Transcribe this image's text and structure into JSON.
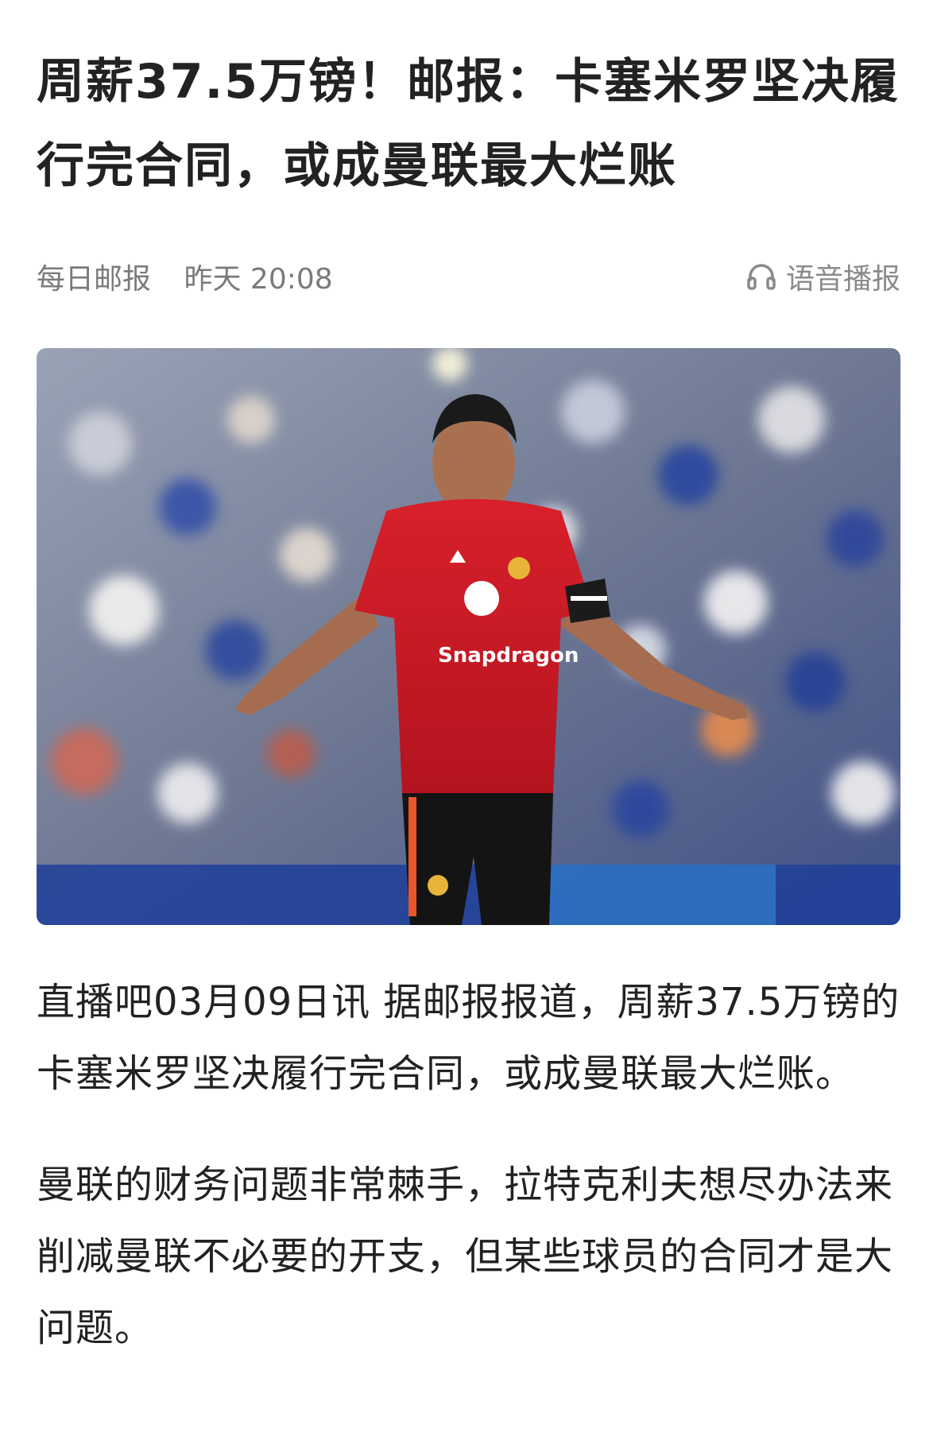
{
  "article": {
    "title": "周薪37.5万镑！邮报：卡塞米罗坚决履行完合同，或成曼联最大烂账",
    "source": "每日邮报",
    "time": "昨天 20:08",
    "audio_label": "语音播报",
    "audio_icon": "headphones-icon",
    "image": {
      "sponsor_text": "Snapdragon",
      "description_icon": "football-player-photo"
    },
    "paragraphs": [
      "直播吧03月09日讯  据邮报报道，周薪37.5万镑的卡塞米罗坚决履行完合同，或成曼联最大烂账。",
      "曼联的财务问题非常棘手，拉特克利夫想尽办法来削减曼联不必要的开支，但某些球员的合同才是大问题。"
    ]
  },
  "colors": {
    "text": "#222222",
    "meta": "#7a7a7a",
    "jersey_red": "#c8102e"
  }
}
